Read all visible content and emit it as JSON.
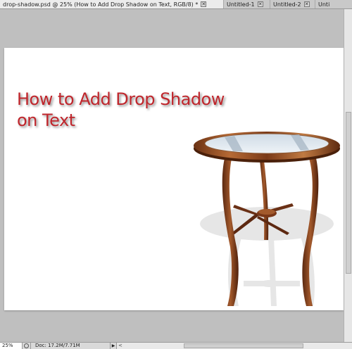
{
  "tabs": [
    {
      "label": "drop-shadow.psd @ 25% (How to Add Drop Shadow  on Text, RGB/8) *",
      "close": "✕"
    },
    {
      "label": "Untitled-1",
      "close": "✕"
    },
    {
      "label": "Untitled-2",
      "close": "✕"
    },
    {
      "label": "Unti",
      "close": ""
    }
  ],
  "canvas": {
    "headline_line1": "How to Add Drop Shadow",
    "headline_line2": "on Text"
  },
  "status": {
    "zoom": "25%",
    "doc_info": "Doc: 17.2M/7.71M",
    "doc_menu_arrow": "▶",
    "scroll_left_arrow": "<"
  },
  "colors": {
    "headline": "#c0262c",
    "workspace": "#bfbfbf",
    "document": "#ffffff"
  },
  "icons": {
    "status_nav": "navigator-icon",
    "table_image": "round-glass-table"
  }
}
